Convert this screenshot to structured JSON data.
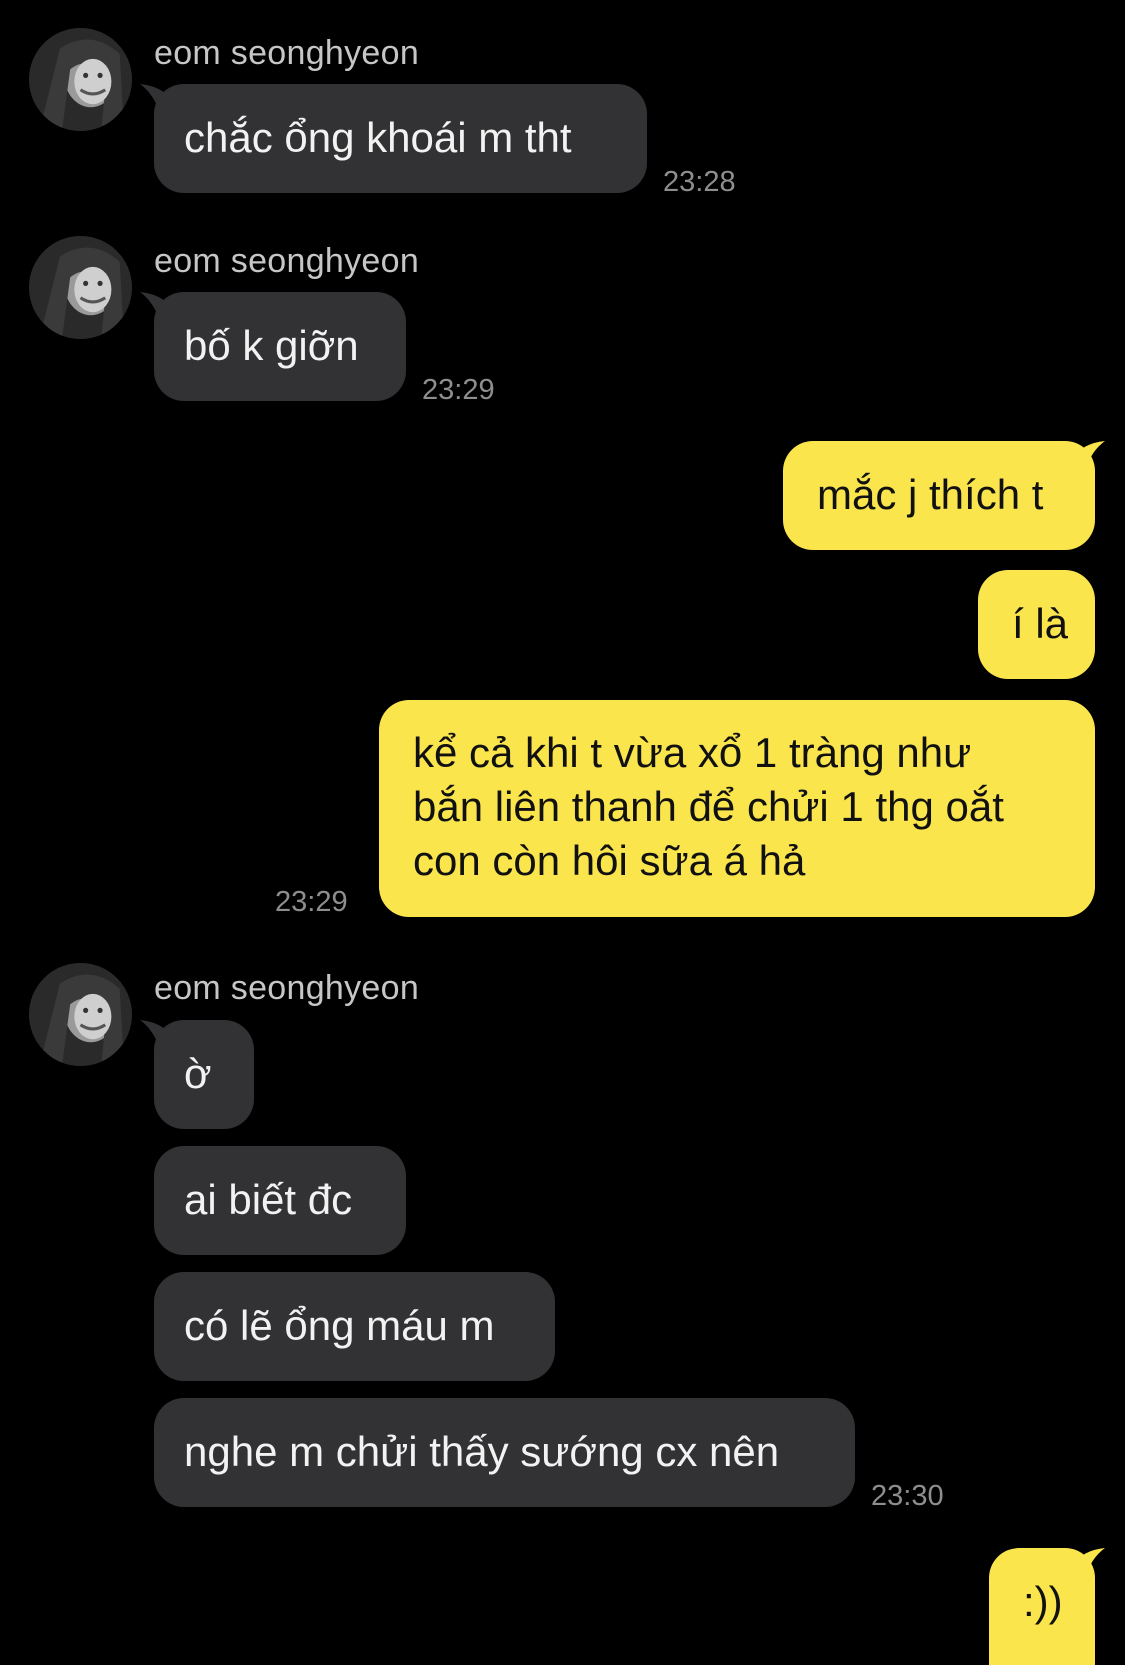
{
  "chat": {
    "messages": [
      {
        "sender": "eom seonghyeon",
        "text": "chắc ổng khoái m tht",
        "time": "23:28"
      },
      {
        "sender": "eom seonghyeon",
        "text": "bố k giỡn",
        "time": "23:29"
      },
      {
        "text": "mắc j thích t"
      },
      {
        "text": "í là"
      },
      {
        "lines": [
          "kể cả khi t vừa xổ 1 tràng như",
          "bắn liên thanh để chửi 1 thg oắt",
          "con còn hôi sữa á hả"
        ],
        "time": "23:29"
      },
      {
        "sender": "eom seonghyeon",
        "text": "ờ"
      },
      {
        "text": "ai biết đc"
      },
      {
        "text": "có lẽ ổng máu m"
      },
      {
        "text": "nghe m chửi thấy sướng cx nên",
        "time": "23:30"
      },
      {
        "text": ":))"
      }
    ]
  },
  "colors": {
    "background": "#000000",
    "incoming_bubble": "#323234",
    "outgoing_bubble": "#fae54d",
    "incoming_text": "#f2f2f2",
    "outgoing_text": "#111111",
    "timestamp": "#8e8e8e",
    "sender_name": "#c6c6c6"
  },
  "icons": {
    "avatar": "contact-avatar-photo"
  }
}
